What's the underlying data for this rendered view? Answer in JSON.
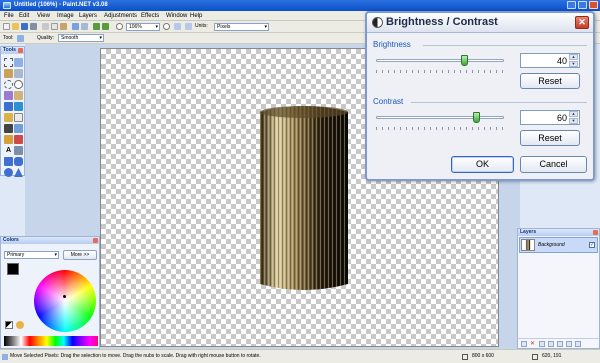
{
  "window": {
    "title": "Untitled (106%) - Paint.NET v3.08"
  },
  "menu": [
    "File",
    "Edit",
    "View",
    "Image",
    "Layers",
    "Adjustments",
    "Effects",
    "Window",
    "Help"
  ],
  "toolbar": {
    "zoom_value": "106%",
    "units_label": "Units:",
    "units_value": "Pixels",
    "tool_label": "Tool:",
    "quality_label": "Quality:",
    "quality_value": "Smooth"
  },
  "tools_panel": {
    "title": "Tools"
  },
  "colors_panel": {
    "title": "Colors",
    "mode": "Primary",
    "more_button": "More >>"
  },
  "layers_panel": {
    "title": "Layers",
    "layers": [
      {
        "name": "Background",
        "visible": true
      }
    ]
  },
  "dialog": {
    "title": "Brightness / Contrast",
    "brightness": {
      "label": "Brightness",
      "value": "40",
      "reset": "Reset",
      "level": 0.7
    },
    "contrast": {
      "label": "Contrast",
      "value": "60",
      "reset": "Reset",
      "level": 0.8
    },
    "ok": "OK",
    "cancel": "Cancel"
  },
  "status": {
    "message": "Move Selected Pixels: Drag the selection to move. Drag the nubs to scale. Drag with right mouse button to rotate.",
    "image_size": "800 x 600",
    "cursor_position": "620, 191"
  },
  "colors": {
    "accent": "#1c55c4",
    "titlebar": "#0a4fc7",
    "close": "#c53f28",
    "slider_thumb": "#3fa63a"
  }
}
